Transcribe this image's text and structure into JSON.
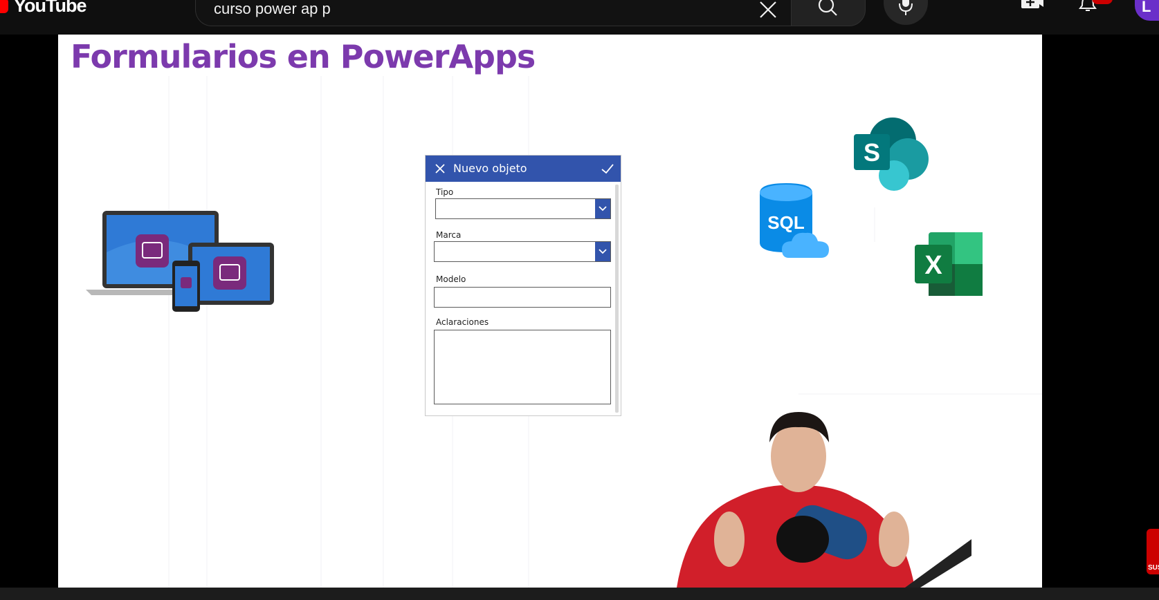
{
  "app": {
    "logo_text": "YouTube"
  },
  "search": {
    "value": "curso power ap p"
  },
  "slide": {
    "title": "Formularios en PowerApps",
    "form": {
      "title": "Nuevo objeto",
      "fields": [
        {
          "label": "Tipo",
          "type": "dropdown"
        },
        {
          "label": "Marca",
          "type": "dropdown"
        },
        {
          "label": "Modelo",
          "type": "text"
        },
        {
          "label": "Aclaraciones",
          "type": "textarea"
        }
      ]
    },
    "logos": {
      "sql_text": "SQL",
      "sharepoint_letter": "S",
      "excel_letter": "X"
    }
  },
  "side": {
    "subscribe_label": "SUS"
  },
  "header": {
    "avatar_letter": "L"
  },
  "colors": {
    "title_purple": "#7c3aad",
    "form_blue": "#3254ac",
    "youtube_red": "#ff0000"
  }
}
